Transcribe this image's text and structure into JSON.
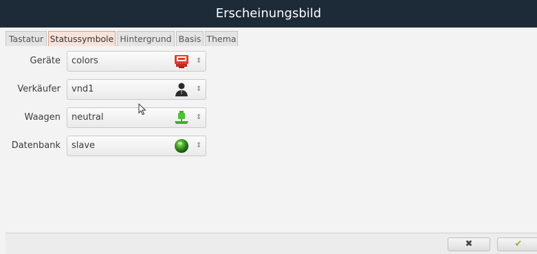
{
  "window": {
    "title": "Erscheinungsbild"
  },
  "tabs": [
    {
      "label": "Tastatur",
      "active": false
    },
    {
      "label": "Statussymbole",
      "active": true
    },
    {
      "label": "Hintergrund",
      "active": false
    },
    {
      "label": "Basis",
      "active": false
    },
    {
      "label": "Thema",
      "active": false
    }
  ],
  "fields": [
    {
      "label": "Geräte",
      "value": "colors",
      "icon": "device-status-icon"
    },
    {
      "label": "Verkäufer",
      "value": "vnd1",
      "icon": "person-icon"
    },
    {
      "label": "Waagen",
      "value": "neutral",
      "icon": "scale-icon"
    },
    {
      "label": "Datenbank",
      "value": "slave",
      "icon": "database-globe-icon"
    }
  ],
  "footer": {
    "cancel_symbol": "✖",
    "ok_symbol": "✔"
  },
  "colors": {
    "titlebar": "#1d2a38",
    "active_tab": "#f7e3d9",
    "ok_green": "#8ab63c"
  }
}
